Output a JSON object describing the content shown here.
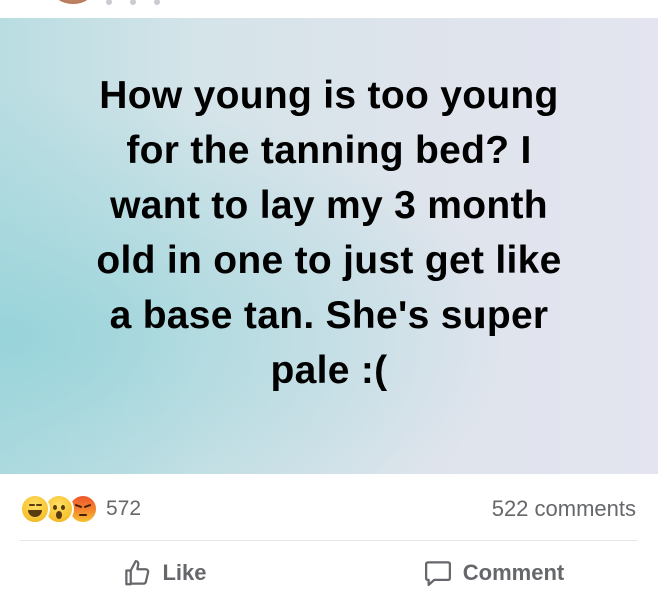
{
  "post": {
    "lines": [
      "How young is too young",
      "for the tanning bed? I",
      "want to lay my 3 month",
      "old in one to just get like",
      "a base tan. She's super",
      "pale :("
    ]
  },
  "stats": {
    "reaction_icons": [
      "haha-icon",
      "wow-icon",
      "angry-icon"
    ],
    "reaction_count": "572",
    "comment_count": "522 comments"
  },
  "actions": {
    "like_label": "Like",
    "comment_label": "Comment"
  },
  "colors": {
    "text_secondary": "#65676b",
    "divider": "#e4e6eb",
    "post_text": "#000000"
  }
}
